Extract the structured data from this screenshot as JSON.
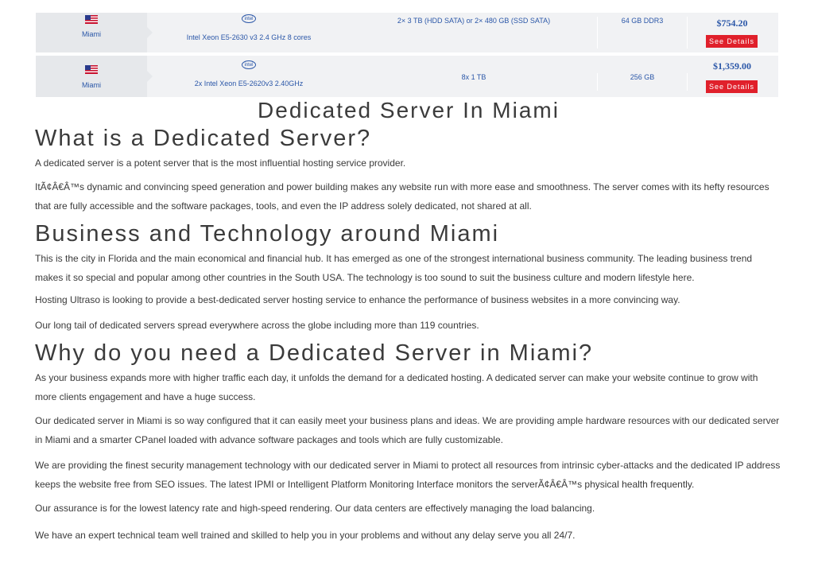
{
  "plans": [
    {
      "location": "Miami",
      "cpu": "Intel Xeon E5-2630 v3 2.4 GHz 8 cores",
      "storage": "2× 3 TB (HDD SATA) or 2× 480 GB (SSD SATA)",
      "ram": "64 GB DDR3",
      "price": "$754.20",
      "button": "See Details"
    },
    {
      "location": "Miami",
      "cpu": "2x Intel Xeon E5-2620v3 2.40GHz",
      "storage": "8x 1 TB",
      "ram": "256 GB",
      "price": "$1,359.00",
      "button": "See Details"
    }
  ],
  "icons": {
    "flag": "us-flag-icon",
    "cpu": "intel-logo-icon",
    "intel_text": "intel"
  },
  "colors": {
    "accent": "#2b57a8",
    "button": "#e0202b",
    "row_bg": "#f1f2f4"
  },
  "article": {
    "title": "Dedicated Server In Miami",
    "h_what": "What is a Dedicated Server?",
    "p_what_1": "A dedicated server is a potent server that is the most influential hosting service provider.",
    "p_what_2": "ItÃ¢Â€Â™s dynamic and convincing speed generation and power building makes any website run with more ease and smoothness. The server comes with its hefty resources that are fully accessible and the software packages, tools, and even the IP address solely dedicated, not shared at all.",
    "h_business": "Business and Technology around Miami",
    "p_business_1": "This is the city in Florida and the main economical and financial hub. It has emerged as one of the strongest international business community. The leading business trend makes it so special and popular among other countries in the South USA. The technology is too sound to suit the business culture and modern lifestyle here.",
    "p_business_2": "Hosting Ultraso is looking to provide a best-dedicated server hosting service to enhance the performance of business websites in a more convincing way.",
    "p_business_3": "Our long tail of dedicated servers spread everywhere across the globe including more than 119 countries.",
    "h_why": "Why do you need a Dedicated Server in Miami?",
    "p_why_1": "As your business expands more with higher traffic each day, it unfolds the demand for a dedicated hosting. A dedicated server can make your website continue to grow with more clients engagement and have a huge success.",
    "p_why_2": "Our dedicated server in Miami is so way configured that it can easily meet your business plans and ideas. We are providing ample hardware resources with our dedicated server in Miami and a smarter CPanel loaded with advance software packages and tools which are fully customizable.",
    "p_why_3": "We are providing the finest security management technology with our dedicated server in Miami to protect all resources from intrinsic cyber-attacks and the dedicated IP address keeps the website free from SEO issues. The latest IPMI or Intelligent Platform Monitoring Interface monitors the serverÃ¢Â€Â™s physical health frequently.",
    "p_why_4": "Our assurance is for the lowest latency rate and high-speed rendering. Our data centers are effectively managing the load balancing.",
    "p_why_5": "We have an expert technical team well trained and skilled to help you in your problems and without any delay serve you all 24/7."
  }
}
